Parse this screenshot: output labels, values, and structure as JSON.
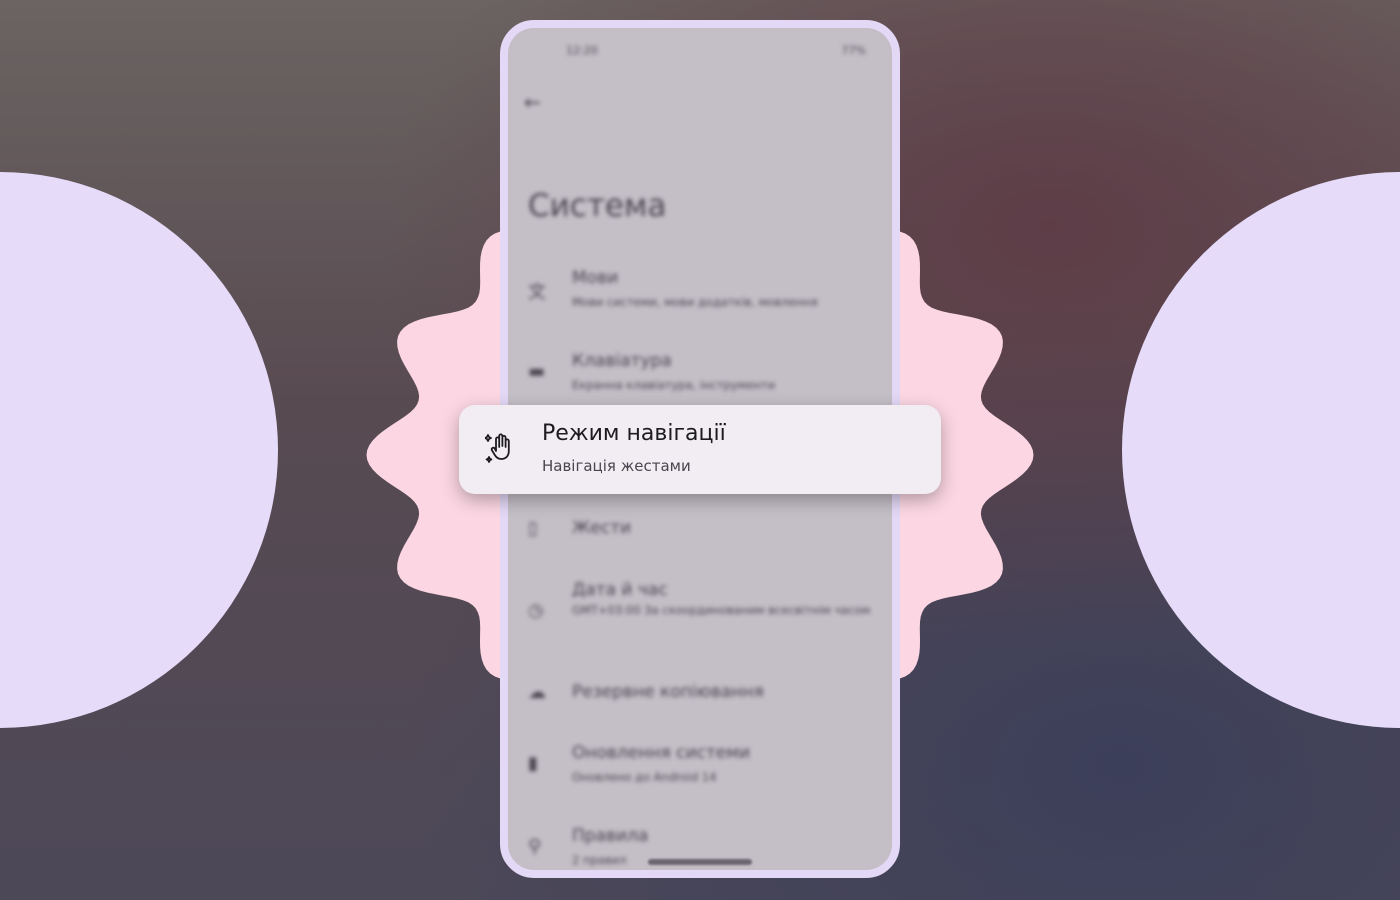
{
  "status_bar": {
    "time": "12:20",
    "battery": "77%"
  },
  "page_title": "Система",
  "items": [
    {
      "title": "Мови",
      "subtitle": "Мови системи, мови додатків, мовлення",
      "icon": "translate-icon"
    },
    {
      "title": "Клавіатура",
      "subtitle": "Екранна клавіатура, інструменти",
      "icon": "keyboard-icon"
    },
    {
      "title": "Жести",
      "subtitle": "",
      "icon": "phone-gesture-icon"
    },
    {
      "title": "Дата й час",
      "subtitle": "GMT+03:00 За скоординованим всесвітнім часом",
      "icon": "clock-icon"
    },
    {
      "title": "Резервне копіювання",
      "subtitle": "",
      "icon": "backup-icon"
    },
    {
      "title": "Оновлення системи",
      "subtitle": "Оновлено до Android 14",
      "icon": "system-update-icon"
    },
    {
      "title": "Правила",
      "subtitle": "2 правил",
      "icon": "rules-icon"
    }
  ],
  "highlight": {
    "title": "Режим навігації",
    "subtitle": "Навігація жестами",
    "icon": "gesture-hand-icon"
  },
  "colors": {
    "circle": "#e6dcfa",
    "blob": "#fcd7e3",
    "frame": "#e3d8f6"
  }
}
